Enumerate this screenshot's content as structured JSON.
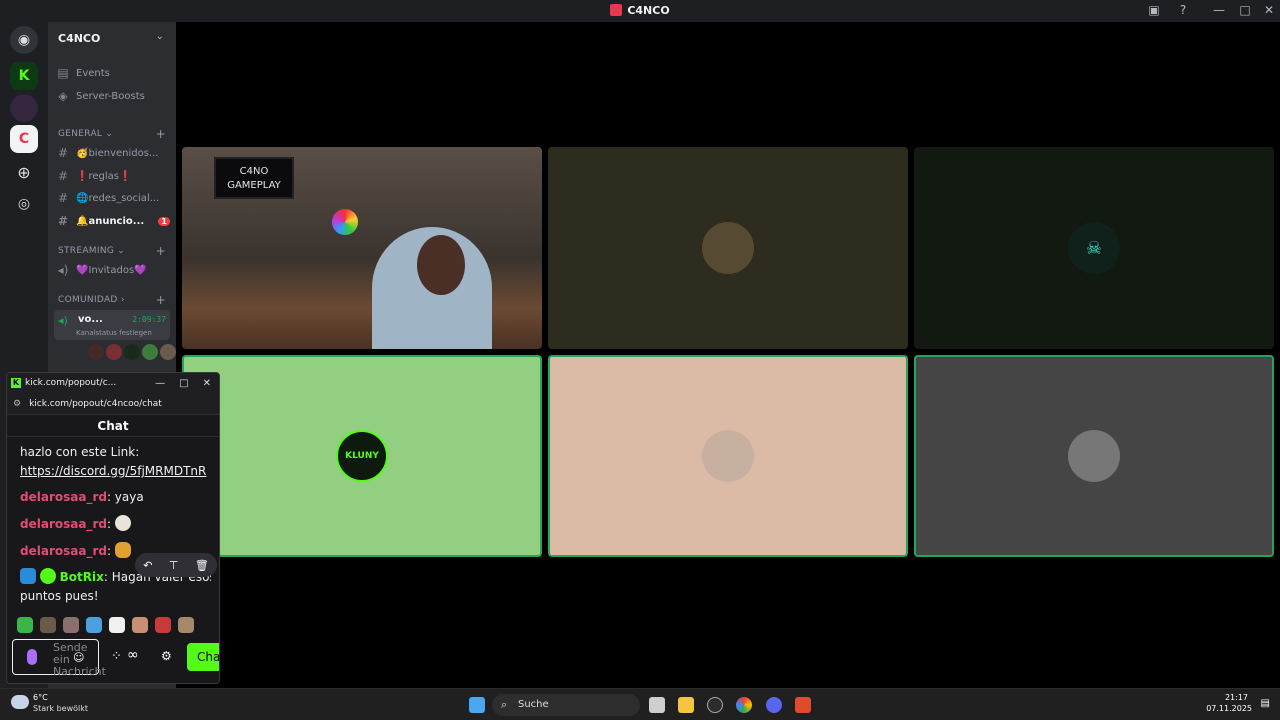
{
  "window": {
    "title": "C4NCO"
  },
  "server": {
    "name": "C4NCO"
  },
  "sidebar": {
    "top_items": [
      {
        "label": "Events",
        "icon": "calendar-icon"
      },
      {
        "label": "Server-Boosts",
        "icon": "boost-icon"
      }
    ],
    "categories": [
      {
        "label": "GENERAL ⌄"
      },
      {
        "label": "STREAMING ⌄"
      },
      {
        "label": "COMUNIDAD ›"
      }
    ],
    "channels": [
      {
        "label": "🥳bienvenidos...",
        "icon": "#"
      },
      {
        "label": "❗reglas❗",
        "icon": "#"
      },
      {
        "label": "🌐redes_social...",
        "icon": "#"
      },
      {
        "label": "🔔anuncio...",
        "icon": "#",
        "badge": "1"
      },
      {
        "label": "💜Invitados💜",
        "icon": "speaker-icon"
      }
    ],
    "voice": {
      "label": "vo...",
      "timer": "2:09:37",
      "status": "Kanalstatus festlegen"
    }
  },
  "stage": {
    "tiles": [
      {
        "label": "C4NO GAMEPLAY",
        "bg": "#3d3631",
        "kind": "webcam"
      },
      {
        "label": "",
        "bg": "#2e2b1f"
      },
      {
        "label": "",
        "bg": "#111910"
      },
      {
        "label": "KLUNY",
        "bg": "#93cf80"
      },
      {
        "label": "",
        "bg": "#dbbba6"
      },
      {
        "label": "",
        "bg": "#464546"
      }
    ]
  },
  "popup": {
    "window_title": "kick.com/popout/c...",
    "url": "kick.com/popout/c4ncoo/chat",
    "chat_title": "Chat",
    "messages": [
      {
        "text": "hazlo con este Link:"
      },
      {
        "text": "https://discord.gg/5fjMRMDTnR"
      },
      {
        "user": "delarosaa_rd",
        "text": ": yaya"
      },
      {
        "user": "delarosaa_rd",
        "text": ":"
      },
      {
        "user": "delarosaa_rd",
        "text": ":"
      },
      {
        "user": "BotRix",
        "text": ": Hagan valer esos"
      },
      {
        "text": "puntos pues!"
      }
    ],
    "input_placeholder": "Sende ein Nachricht",
    "send_label": "Chat"
  },
  "taskbar": {
    "weather_temp": "6°C",
    "weather_desc": "Stark bewölkt",
    "search_label": "Suche",
    "time": "21:17",
    "date": "07.11.2025"
  }
}
